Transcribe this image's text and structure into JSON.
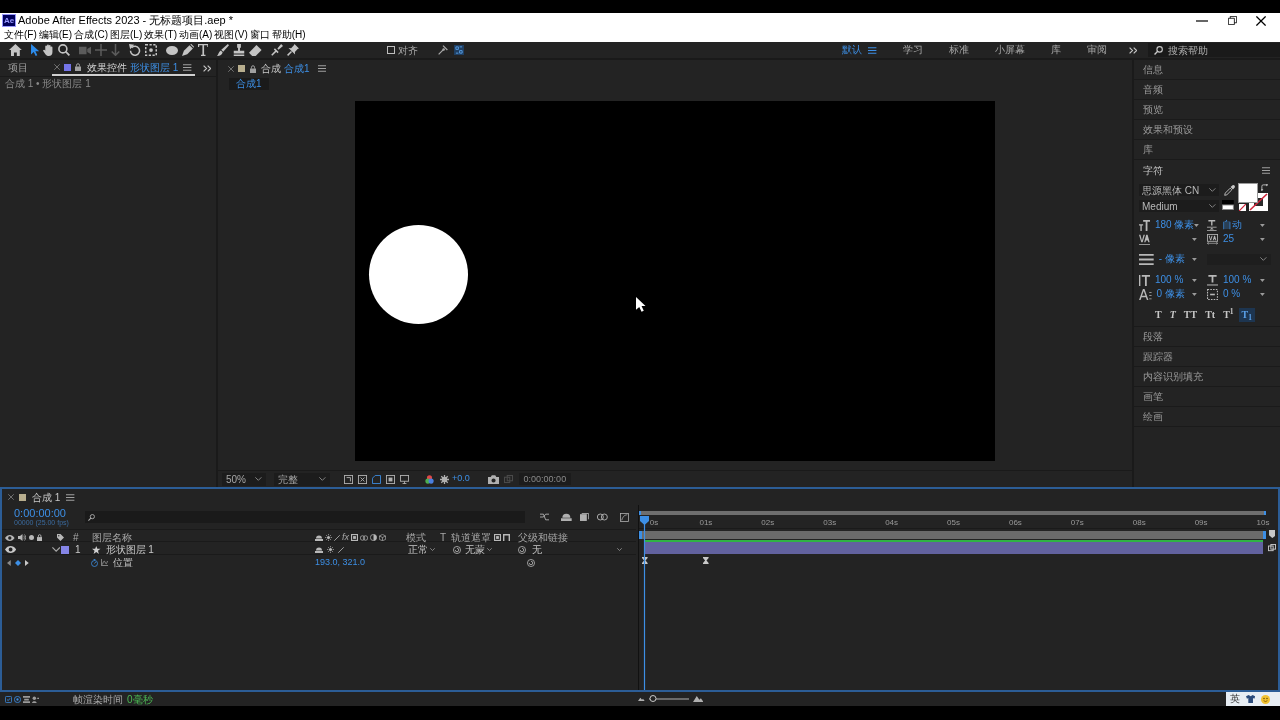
{
  "title_bar": {
    "logo": "Ae",
    "title": "Adobe After Effects 2023 - 无标题项目.aep *"
  },
  "menu_bar": [
    "文件(F)",
    "编辑(E)",
    "合成(C)",
    "图层(L)",
    "效果(T)",
    "动画(A)",
    "视图(V)",
    "窗口",
    "帮助(H)"
  ],
  "toolbar": {
    "tools": [
      {
        "kind": "home",
        "selected": false,
        "disabled": false
      },
      {
        "kind": "selection",
        "selected": true,
        "disabled": false
      },
      {
        "kind": "hand",
        "selected": false,
        "disabled": false
      },
      {
        "kind": "zoom",
        "selected": false,
        "disabled": false
      },
      {
        "kind": "orbit",
        "selected": false,
        "disabled": true
      },
      {
        "kind": "pan",
        "selected": false,
        "disabled": true
      },
      {
        "kind": "dolly",
        "selected": false,
        "disabled": true
      },
      {
        "kind": "rotate",
        "selected": false,
        "disabled": false
      },
      {
        "kind": "anchor",
        "selected": false,
        "disabled": false
      },
      {
        "kind": "ellipse",
        "selected": false,
        "disabled": false
      },
      {
        "kind": "pen",
        "selected": false,
        "disabled": false
      },
      {
        "kind": "text",
        "selected": false,
        "disabled": false
      },
      {
        "kind": "brush",
        "selected": false,
        "disabled": false
      },
      {
        "kind": "stamp",
        "selected": false,
        "disabled": false
      },
      {
        "kind": "eraser",
        "selected": false,
        "disabled": false
      },
      {
        "kind": "roto",
        "selected": false,
        "disabled": false
      },
      {
        "kind": "pin",
        "selected": false,
        "disabled": false
      }
    ],
    "snap": {
      "label": "对齐",
      "checked": false
    },
    "workspaces": [
      {
        "label": "默认",
        "selected": true
      },
      {
        "label": "学习",
        "selected": false
      },
      {
        "label": "标准",
        "selected": false
      },
      {
        "label": "小屏幕",
        "selected": false
      },
      {
        "label": "库",
        "selected": false
      },
      {
        "label": "审阅",
        "selected": false
      }
    ],
    "search": {
      "placeholder": "搜索帮助"
    }
  },
  "left_panel": {
    "tabs": [
      {
        "label": "项目",
        "selected": false
      },
      {
        "label": "效果控件",
        "target": "形状图层 1",
        "selected": true
      }
    ],
    "breadcrumb": "合成 1 • 形状图层 1"
  },
  "composition_panel": {
    "tab": {
      "label": "合成",
      "target": "合成1"
    },
    "sub_tab": "合成1",
    "footer": {
      "zoom": "50%",
      "resolution": "完整",
      "exposure": "+0.0",
      "timecode": "0:00:00:00"
    }
  },
  "right_panel": {
    "panels_above": [
      "信息",
      "音频",
      "预览",
      "效果和预设",
      "库"
    ],
    "character": {
      "title": "字符",
      "font_family": "思源黑体 CN",
      "font_style": "Medium",
      "size": "180 像素",
      "leading": "自动",
      "tracking": "25",
      "stroke_width": "- 像素",
      "vertical_scale": "100 %",
      "horizontal_scale": "100 %",
      "baseline_shift": "0 像素",
      "tsume": "0 %",
      "styles": [
        {
          "kind": "faux_bold",
          "label": "T",
          "selected": false
        },
        {
          "kind": "faux_italic",
          "label": "T",
          "selected": false
        },
        {
          "kind": "all_caps",
          "label": "TT",
          "selected": false
        },
        {
          "kind": "small_caps",
          "label": "Tt",
          "selected": false
        },
        {
          "kind": "superscript",
          "label": "T$^{1}$",
          "selected": false
        },
        {
          "kind": "subscript",
          "label": "T$_{1}$",
          "selected": true
        }
      ]
    },
    "panels_below": [
      "段落",
      "跟踪器",
      "内容识别填充",
      "画笔",
      "绘画"
    ]
  },
  "timeline": {
    "tab": "合成 1",
    "timecode": "0:00:00:00",
    "frame_info": "00000 (25.00 fps)",
    "columns": {
      "number": "#",
      "name": "图层名称",
      "effects": "fx",
      "mode": "模式",
      "preserve_transparency": "T",
      "track_matte": "轨道遮罩",
      "parent": "父级和链接"
    },
    "layers": [
      {
        "number": "1",
        "name": "形状图层 1",
        "color": "#8585e6",
        "visible": true,
        "expanded": true,
        "mode": "正常",
        "track_matte": "无蒙",
        "parent": "无",
        "properties": [
          {
            "name": "位置",
            "value": "193.0, 321.0"
          }
        ]
      }
    ],
    "ruler": [
      "0s",
      "01s",
      "02s",
      "03s",
      "04s",
      "05s",
      "06s",
      "07s",
      "08s",
      "09s",
      "10s"
    ]
  },
  "status_bar": {
    "label": "帧渲染时间",
    "value": "0毫秒",
    "zoom_slider": {
      "level": 0.12
    },
    "ime": "英"
  }
}
